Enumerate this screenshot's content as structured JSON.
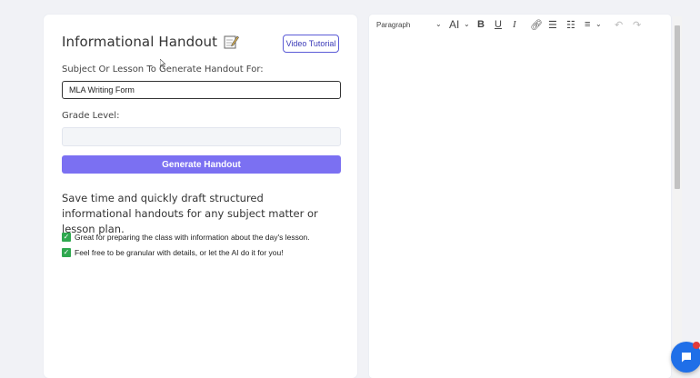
{
  "form": {
    "title": "Informational Handout",
    "video_button": "Video Tutorial",
    "subject_label": "Subject Or Lesson To Generate Handout For:",
    "subject_value": "MLA Writing Form",
    "grade_label": "Grade Level:",
    "grade_value": "",
    "generate_button": "Generate Handout",
    "description": "Save time and quickly draft structured informational handouts for any subject matter or lesson plan.",
    "bullets": [
      "Great for preparing the class with information about the day's lesson.",
      "Feel free to be granular with details, or let the AI do it for you!"
    ]
  },
  "editor": {
    "block_style": "Paragraph",
    "ai_label": "AI"
  },
  "colors": {
    "primary_button": "#7b70f2",
    "check": "#2fa84f",
    "chat": "#1f6fe8"
  },
  "icons": [
    "note-edit-icon",
    "check-icon",
    "chevron-down-icon",
    "bold-icon",
    "underline-icon",
    "italic-icon",
    "link-icon",
    "bullet-list-icon",
    "numbered-list-icon",
    "align-icon",
    "undo-icon",
    "redo-icon",
    "chat-icon"
  ]
}
